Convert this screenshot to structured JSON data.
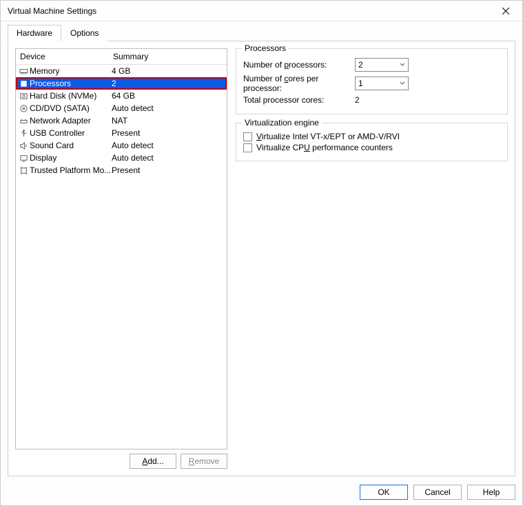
{
  "window": {
    "title": "Virtual Machine Settings"
  },
  "tabs": {
    "hardware": "Hardware",
    "options": "Options"
  },
  "list": {
    "headers": {
      "device": "Device",
      "summary": "Summary"
    },
    "items": [
      {
        "name": "Memory",
        "summary": "4 GB"
      },
      {
        "name": "Processors",
        "summary": "2"
      },
      {
        "name": "Hard Disk (NVMe)",
        "summary": "64 GB"
      },
      {
        "name": "CD/DVD (SATA)",
        "summary": "Auto detect"
      },
      {
        "name": "Network Adapter",
        "summary": "NAT"
      },
      {
        "name": "USB Controller",
        "summary": "Present"
      },
      {
        "name": "Sound Card",
        "summary": "Auto detect"
      },
      {
        "name": "Display",
        "summary": "Auto detect"
      },
      {
        "name": "Trusted Platform Mo...",
        "summary": "Present"
      }
    ]
  },
  "buttons": {
    "add": "Add...",
    "remove": "Remove",
    "ok": "OK",
    "cancel": "Cancel",
    "help": "Help"
  },
  "processors": {
    "legend": "Processors",
    "num_label": "Number of processors:",
    "num_value": "2",
    "cores_label": "Number of cores per processor:",
    "cores_value": "1",
    "total_label": "Total processor cores:",
    "total_value": "2"
  },
  "virt": {
    "legend": "Virtualization engine",
    "vt": "Virtualize Intel VT-x/EPT or AMD-V/RVI",
    "cpu": "Virtualize CPU performance counters"
  }
}
